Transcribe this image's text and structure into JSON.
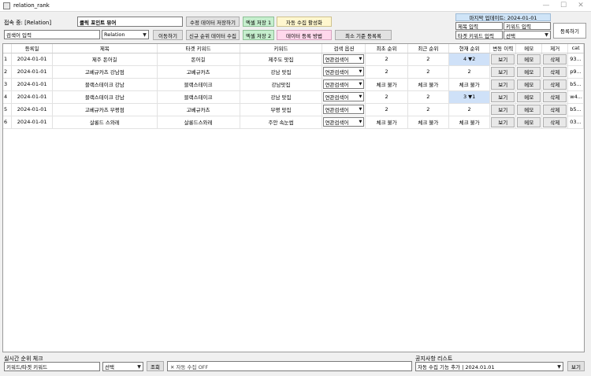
{
  "window": {
    "title": "relation_rank",
    "minimize": "—",
    "maximize": "☐",
    "close": "✕"
  },
  "top": {
    "connection_label": "접속 중: [Relation]",
    "viewer_title": "클릭 포인트 뷰어",
    "btn_save_edit": "수정 데이터 저장하기",
    "btn_excel1": "엑셀 저장 1",
    "btn_auto_collect": "자동 수집 활성화",
    "search_placeholder": "검색어 입력",
    "relation_select": "Relation",
    "btn_move": "이동하기",
    "btn_new_rank": "신규 순위 데이터 수집",
    "btn_excel2": "엑셀 저장 2",
    "btn_register_method": "데이터 등록 방법",
    "btn_min_register": "최소 기준 등록록"
  },
  "reg_panel": {
    "last_update": "마지막 업데이트: 2024-01-01",
    "title_placeholder": "제목 입력",
    "keyword_placeholder": "키워드 입력",
    "target_placeholder": "타겟 키워드 입력",
    "select_label": "선택",
    "btn_register": "등록하기"
  },
  "table": {
    "columns": [
      "등록일",
      "제목",
      "타겟 키워드",
      "키워드",
      "검색 옵션",
      "최초 순위",
      "최근 순위",
      "현재 순위",
      "변동 이력",
      "메모",
      "제거",
      "cat"
    ],
    "rows": [
      {
        "num": "1",
        "date": "2024-01-01",
        "title": "제주 돈어길",
        "target": "돈어길",
        "keyword": "제주도 맛집",
        "option": "연관검색어",
        "first": "2",
        "recent": "2",
        "current": "4 ▼2",
        "highlight": true,
        "history": "보기",
        "memo": "메모",
        "remove": "삭제",
        "cat": "93..."
      },
      {
        "num": "2",
        "date": "2024-01-01",
        "title": "고베규카츠 강남점",
        "target": "고베규카츠",
        "keyword": "강남 맛집",
        "option": "연관검색어",
        "first": "2",
        "recent": "2",
        "current": "2",
        "highlight": false,
        "history": "보기",
        "memo": "메모",
        "remove": "삭제",
        "cat": "p9..."
      },
      {
        "num": "3",
        "date": "2024-01-01",
        "title": "블랙스테이크 강남",
        "target": "블랙스테이크",
        "keyword": "강남맛집",
        "option": "연관검색어",
        "first": "체크 불가",
        "recent": "체크 불가",
        "current": "체크 불가",
        "highlight": false,
        "history": "보기",
        "memo": "메모",
        "remove": "삭제",
        "cat": "b5..."
      },
      {
        "num": "4",
        "date": "2024-01-01",
        "title": "블랙스테이크 강남",
        "target": "블랙스테이크",
        "keyword": "강남 맛집",
        "option": "연관검색어",
        "first": "2",
        "recent": "2",
        "current": "3 ▼1",
        "highlight": true,
        "history": "보기",
        "memo": "메모",
        "remove": "삭제",
        "cat": "w4..."
      },
      {
        "num": "5",
        "date": "2024-01-01",
        "title": "고베규카츠 부평점",
        "target": "고베규카츠",
        "keyword": "부평 맛집",
        "option": "연관검색어",
        "first": "2",
        "recent": "2",
        "current": "2",
        "highlight": false,
        "history": "보기",
        "memo": "메모",
        "remove": "삭제",
        "cat": "b5..."
      },
      {
        "num": "6",
        "date": "2024-01-01",
        "title": "살롱드 스와레",
        "target": "살롱드스와레",
        "keyword": "주안 속눈썹",
        "option": "연관검색어",
        "first": "체크 불가",
        "recent": "체크 불가",
        "current": "체크 불가",
        "highlight": false,
        "history": "보기",
        "memo": "메모",
        "remove": "삭제",
        "cat": "03..."
      }
    ]
  },
  "bottom": {
    "realtime_label": "실시간 순위 체크",
    "keyword_placeholder": "키워드/타겟 키워드",
    "select_label": "선택",
    "btn_query": "조회",
    "auto_status": "✕ 자동 수집 OFF",
    "notice_label": "공지사항 리스트",
    "notice_select": "자동 수집 기능 추가 | 2024.01.01",
    "btn_view": "보기"
  },
  "colors": {
    "highlight": "#cfe1f8",
    "green_button": "#c6efce",
    "pink_button": "#ffd8ec",
    "panel_header": "#cfe4f7"
  }
}
